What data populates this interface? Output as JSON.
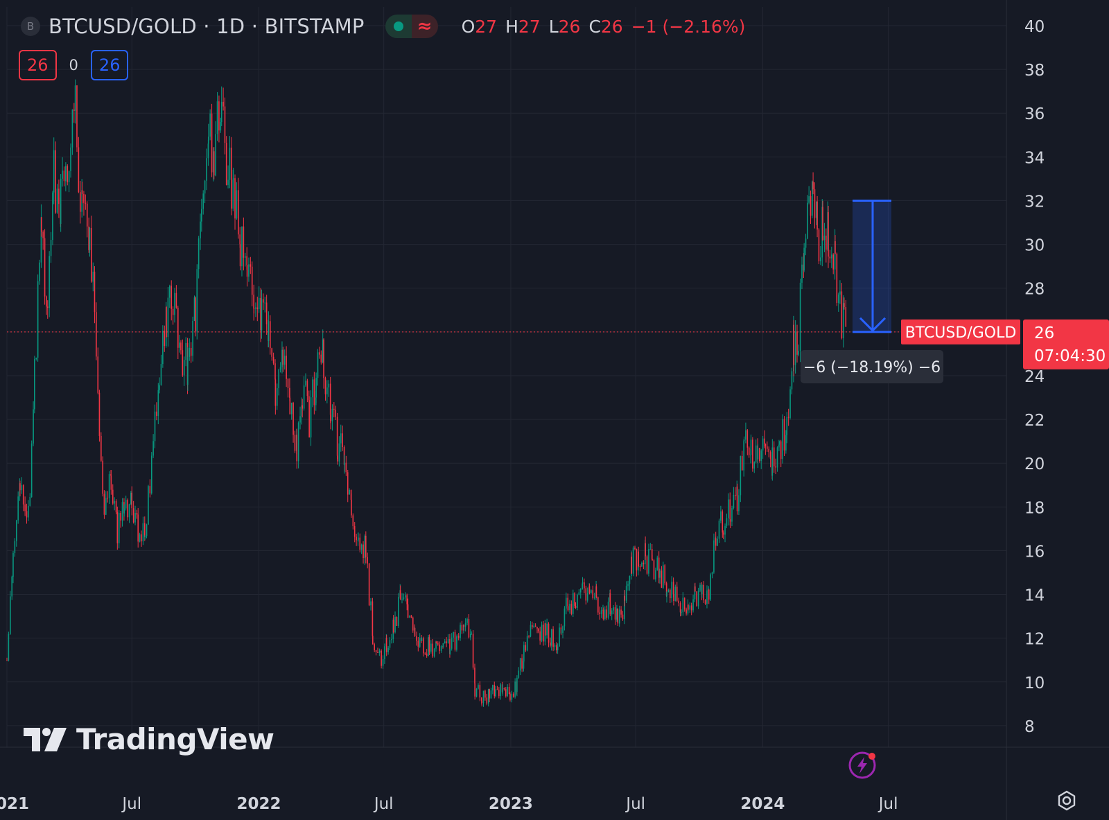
{
  "header": {
    "symbol_icon_letter": "B",
    "title": "BTCUSD/GOLD · 1D · BITSTAMP",
    "wave_glyph": "≈",
    "ohlc": {
      "o_label": "O",
      "o": "27",
      "h_label": "H",
      "h": "27",
      "l_label": "L",
      "l": "26",
      "c_label": "C",
      "c": "26",
      "change": "−1 (−2.16%)"
    }
  },
  "quote_row": {
    "bid": "26",
    "spread": "0",
    "ask": "26"
  },
  "price_axis": {
    "ticks": [
      "40",
      "38",
      "36",
      "34",
      "32",
      "30",
      "28",
      "26",
      "24",
      "22",
      "20",
      "18",
      "16",
      "14",
      "12",
      "10",
      "8"
    ],
    "last_price": "26",
    "countdown": "07:04:30"
  },
  "time_axis": {
    "labels": [
      "2021",
      "Jul",
      "2022",
      "Jul",
      "2023",
      "Jul",
      "2024",
      "Jul"
    ]
  },
  "series_label": "BTCUSD/GOLD",
  "measure": {
    "label": "−6 (−18.19%) −6",
    "from": 32,
    "to": 26
  },
  "watermark": "TradingView",
  "colors": {
    "background": "#161a25",
    "up": "#089981",
    "down": "#f23645",
    "measure": "#2962ff",
    "grid": "#232733"
  },
  "icons": [
    "symbol-circle-icon",
    "status-dot-icon",
    "wave-icon",
    "tradingview-logo-icon",
    "lightning-icon",
    "settings-gear-icon"
  ],
  "chart_data": {
    "type": "candlestick",
    "title": "BTCUSD/GOLD · 1D · BITSTAMP",
    "ylim": [
      7.5,
      40.5
    ],
    "grid": true,
    "x_labels": [
      "2021",
      "Jul",
      "2022",
      "Jul",
      "2023",
      "Jul",
      "2024",
      "Jul"
    ],
    "x_label_dates": [
      "2021-01",
      "2021-07",
      "2022-01",
      "2022-07",
      "2023-01",
      "2023-07",
      "2024-01",
      "2024-07"
    ],
    "close_path": [
      [
        "2021-01-01",
        11.0
      ],
      [
        "2021-01-10",
        15.5
      ],
      [
        "2021-01-20",
        19.0
      ],
      [
        "2021-02-01",
        17.5
      ],
      [
        "2021-02-10",
        24.0
      ],
      [
        "2021-02-20",
        30.5
      ],
      [
        "2021-03-01",
        27.5
      ],
      [
        "2021-03-10",
        33.0
      ],
      [
        "2021-03-20",
        32.0
      ],
      [
        "2021-04-01",
        34.5
      ],
      [
        "2021-04-10",
        36.5
      ],
      [
        "2021-04-20",
        31.0
      ],
      [
        "2021-05-01",
        30.0
      ],
      [
        "2021-05-08",
        28.0
      ],
      [
        "2021-05-15",
        22.0
      ],
      [
        "2021-05-22",
        18.0
      ],
      [
        "2021-06-01",
        19.5
      ],
      [
        "2021-06-10",
        17.0
      ],
      [
        "2021-06-20",
        18.5
      ],
      [
        "2021-07-01",
        18.0
      ],
      [
        "2021-07-10",
        17.0
      ],
      [
        "2021-07-20",
        16.8
      ],
      [
        "2021-08-01",
        21.0
      ],
      [
        "2021-08-10",
        24.5
      ],
      [
        "2021-08-20",
        26.5
      ],
      [
        "2021-09-01",
        27.5
      ],
      [
        "2021-09-10",
        25.5
      ],
      [
        "2021-09-20",
        24.0
      ],
      [
        "2021-10-01",
        27.0
      ],
      [
        "2021-10-10",
        31.5
      ],
      [
        "2021-10-20",
        35.0
      ],
      [
        "2021-10-28",
        34.0
      ],
      [
        "2021-11-08",
        36.5
      ],
      [
        "2021-11-15",
        33.5
      ],
      [
        "2021-11-25",
        32.5
      ],
      [
        "2021-12-05",
        30.0
      ],
      [
        "2021-12-15",
        28.5
      ],
      [
        "2021-12-25",
        28.0
      ],
      [
        "2022-01-05",
        27.0
      ],
      [
        "2022-01-15",
        25.5
      ],
      [
        "2022-01-25",
        23.0
      ],
      [
        "2022-02-05",
        24.5
      ],
      [
        "2022-02-15",
        22.5
      ],
      [
        "2022-02-25",
        21.0
      ],
      [
        "2022-03-05",
        23.5
      ],
      [
        "2022-03-15",
        22.0
      ],
      [
        "2022-03-25",
        23.8
      ],
      [
        "2022-04-05",
        24.8
      ],
      [
        "2022-04-15",
        22.0
      ],
      [
        "2022-04-25",
        21.0
      ],
      [
        "2022-05-05",
        20.5
      ],
      [
        "2022-05-15",
        18.0
      ],
      [
        "2022-05-25",
        16.5
      ],
      [
        "2022-06-05",
        16.0
      ],
      [
        "2022-06-15",
        12.0
      ],
      [
        "2022-06-25",
        11.0
      ],
      [
        "2022-07-05",
        11.8
      ],
      [
        "2022-07-15",
        12.5
      ],
      [
        "2022-07-25",
        13.8
      ],
      [
        "2022-08-05",
        13.5
      ],
      [
        "2022-08-15",
        12.2
      ],
      [
        "2022-08-25",
        11.5
      ],
      [
        "2022-09-05",
        11.8
      ],
      [
        "2022-09-15",
        11.5
      ],
      [
        "2022-09-25",
        11.6
      ],
      [
        "2022-10-05",
        11.8
      ],
      [
        "2022-10-15",
        11.8
      ],
      [
        "2022-10-25",
        12.4
      ],
      [
        "2022-11-05",
        12.3
      ],
      [
        "2022-11-10",
        9.6
      ],
      [
        "2022-11-20",
        9.3
      ],
      [
        "2022-12-01",
        9.5
      ],
      [
        "2022-12-10",
        9.4
      ],
      [
        "2022-12-20",
        9.6
      ],
      [
        "2022-12-31",
        9.3
      ],
      [
        "2023-01-10",
        10.0
      ],
      [
        "2023-01-20",
        11.5
      ],
      [
        "2023-02-01",
        12.3
      ],
      [
        "2023-02-10",
        12.0
      ],
      [
        "2023-02-20",
        12.5
      ],
      [
        "2023-03-01",
        12.0
      ],
      [
        "2023-03-10",
        11.5
      ],
      [
        "2023-03-15",
        12.6
      ],
      [
        "2023-03-25",
        13.5
      ],
      [
        "2023-04-05",
        14.0
      ],
      [
        "2023-04-15",
        14.4
      ],
      [
        "2023-04-25",
        14.0
      ],
      [
        "2023-05-05",
        13.8
      ],
      [
        "2023-05-15",
        13.4
      ],
      [
        "2023-05-25",
        13.5
      ],
      [
        "2023-06-05",
        13.0
      ],
      [
        "2023-06-15",
        13.6
      ],
      [
        "2023-06-25",
        15.5
      ],
      [
        "2023-07-05",
        15.8
      ],
      [
        "2023-07-15",
        15.7
      ],
      [
        "2023-07-25",
        15.4
      ],
      [
        "2023-08-05",
        15.0
      ],
      [
        "2023-08-15",
        14.5
      ],
      [
        "2023-08-25",
        13.8
      ],
      [
        "2023-09-05",
        13.5
      ],
      [
        "2023-09-15",
        13.4
      ],
      [
        "2023-09-25",
        13.8
      ],
      [
        "2023-10-05",
        14.0
      ],
      [
        "2023-10-15",
        14.2
      ],
      [
        "2023-10-25",
        16.5
      ],
      [
        "2023-11-05",
        17.5
      ],
      [
        "2023-11-15",
        18.0
      ],
      [
        "2023-11-25",
        18.5
      ],
      [
        "2023-12-05",
        21.0
      ],
      [
        "2023-12-15",
        20.5
      ],
      [
        "2023-12-25",
        21.0
      ],
      [
        "2024-01-05",
        20.0
      ],
      [
        "2024-01-15",
        20.3
      ],
      [
        "2024-01-25",
        20.5
      ],
      [
        "2024-02-05",
        22.0
      ],
      [
        "2024-02-15",
        25.5
      ],
      [
        "2024-02-22",
        26.0
      ],
      [
        "2024-03-01",
        30.0
      ],
      [
        "2024-03-08",
        32.0
      ],
      [
        "2024-03-14",
        33.3
      ],
      [
        "2024-03-20",
        30.5
      ],
      [
        "2024-03-28",
        30.8
      ],
      [
        "2024-04-05",
        30.5
      ],
      [
        "2024-04-15",
        29.0
      ],
      [
        "2024-04-22",
        27.5
      ],
      [
        "2024-04-28",
        26.0
      ],
      [
        "2024-05-01",
        26.0
      ]
    ]
  }
}
